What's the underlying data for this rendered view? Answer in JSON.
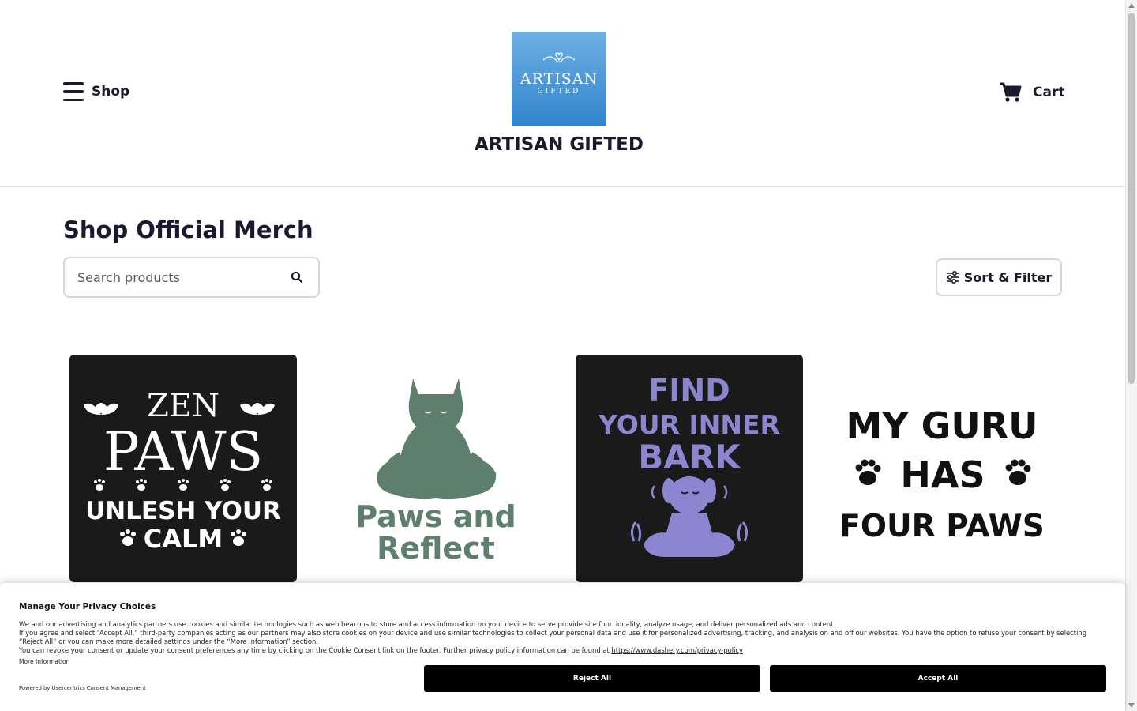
{
  "header": {
    "shop_label": "Shop",
    "cart_label": "Cart",
    "logo_word": "ARTISAN",
    "logo_sub": "GIFTED",
    "brand_title": "ARTISAN GIFTED"
  },
  "main": {
    "heading": "Shop Official Merch",
    "search_placeholder": "Search products",
    "sort_filter_label": "Sort & Filter",
    "products": [
      {
        "line1": "ZEN",
        "line2": "PAWS",
        "line3": "UNLESH YOUR",
        "line4": "CALM"
      },
      {
        "line1": "Paws and",
        "line2": "Reflect"
      },
      {
        "line1": "FIND",
        "line2": "YOUR INNER",
        "line3": "BARK"
      },
      {
        "line1": "MY GURU",
        "line2": "HAS",
        "line3": "FOUR PAWS"
      }
    ]
  },
  "consent": {
    "title": "Manage Your Privacy Choices",
    "p1": "We and our advertising and analytics partners use cookies and similar technologies such as web beacons to store and access information on your device to serve provide site functionality, analyze usage, and deliver personalized ads and content.",
    "p2": "If you agree and select “Accept All,” third-party companies acting as our partners may also store cookies on your device and use similar technologies to collect your personal data and use it for personalized advertising, tracking, and analysis on and off our websites. You have the option to refuse your consent by selecting “Reject All” or you can make more detailed settings under the “More Information” section.",
    "p3": "You can revoke your consent or update your consent preferences any time by clicking on the Cookie Consent link on the footer. Further privacy policy information can be found at",
    "policy_link": "https://www.dashery.com/privacy-policy",
    "more_info": "More Information",
    "powered_by": "Powered by Usercentrics Consent Management",
    "reject_label": "Reject All",
    "accept_label": "Accept All"
  },
  "colors": {
    "text": "#1a1a2e",
    "logo_blue": "#4a9ad8",
    "card_dark": "#1a1a1a",
    "sage_green": "#5e7f6c",
    "lavender": "#8c86d0"
  }
}
